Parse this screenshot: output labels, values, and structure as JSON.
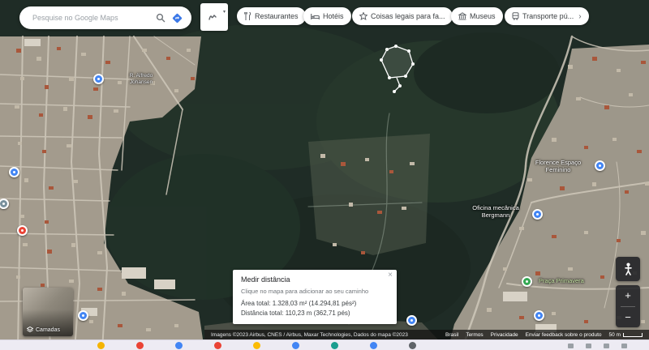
{
  "window": {
    "app": "Google Maps",
    "view": "satellite"
  },
  "palette": {
    "google_blue": "#4285f4",
    "marker_red": "#ea4335",
    "marker_green": "#34a853",
    "control_bg": "#202124",
    "chip_text": "#3c4043",
    "forest_green": "#223329",
    "urban_gray": "#a39b8d",
    "taskbar_bg": "#edebf3",
    "taskbar_icon_colors": [
      "#f5b400",
      "#ea4335",
      "#4285f4",
      "#ea4335",
      "#fbbc04",
      "#4285f4",
      "#1a9e8f",
      "#4285f4",
      "#5f6368"
    ]
  },
  "search": {
    "placeholder": "Pesquise no Google Maps",
    "search_icon": "magnifier-icon",
    "directions_icon": "directions-diamond-icon"
  },
  "toolbox": {
    "icon": "scribble-icon",
    "caret": "▾"
  },
  "chips": [
    {
      "label": "Restaurantes",
      "icon": "restaurant-icon"
    },
    {
      "label": "Hotéis",
      "icon": "hotel-icon"
    },
    {
      "label": "Coisas legais para fa...",
      "icon": "attractions-icon"
    },
    {
      "label": "Museus",
      "icon": "museum-icon"
    },
    {
      "label": "Transporte pú...",
      "icon": "transit-icon",
      "chevron": "›"
    }
  ],
  "measure_card": {
    "title": "Medir distância",
    "hint": "Clique no mapa para adicionar ao seu caminho",
    "area": "Área total: 1.328,03 m² (14.294,81 pés²)",
    "distance": "Distância total: 110,23 m (362,71 pés)",
    "close": "×"
  },
  "map_labels": {
    "florence": "Florence Espaço Feminino",
    "oficina": "Oficina mecânica Bergmann",
    "street": "R. Alfredo Johansen",
    "park": "Praça Primavera"
  },
  "controls": {
    "zoom_in": "+",
    "zoom_out": "−",
    "pegman_icon": "pegman-icon"
  },
  "minimap": {
    "label": "Camadas",
    "icon": "layers-icon"
  },
  "attribution": {
    "imagery": "Imagens ©2023 Airbus, CNES / Airbus, Maxar Technologies, Dados do mapa ©2023",
    "links": [
      "Brasil",
      "Termos",
      "Privacidade",
      "Enviar feedback sobre o produto"
    ],
    "scale": "50 m"
  }
}
